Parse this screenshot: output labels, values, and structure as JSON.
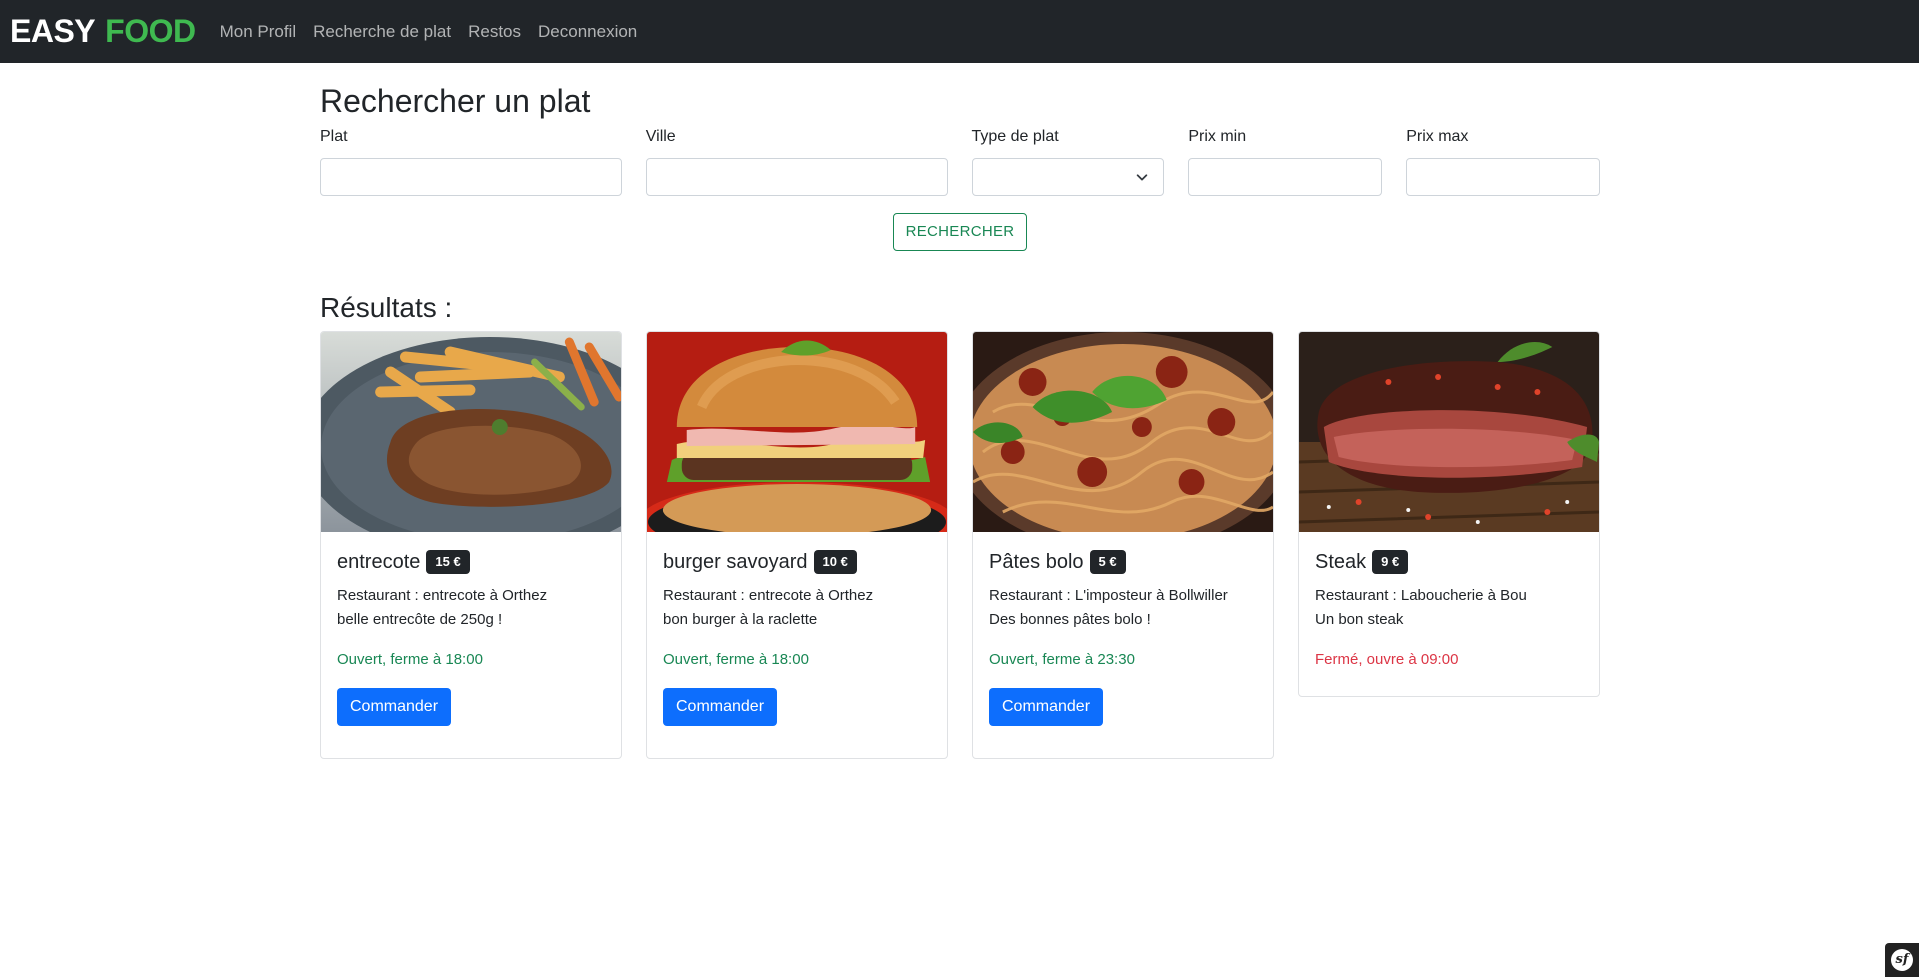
{
  "navbar": {
    "brand_part1": "EASY",
    "brand_part2": "FOOD",
    "links": [
      "Mon Profil",
      "Recherche de plat",
      "Restos",
      "Deconnexion"
    ]
  },
  "search": {
    "title": "Rechercher un plat",
    "fields": {
      "plat": {
        "label": "Plat",
        "value": ""
      },
      "ville": {
        "label": "Ville",
        "value": ""
      },
      "type": {
        "label": "Type de plat",
        "value": ""
      },
      "prix_min": {
        "label": "Prix min",
        "value": ""
      },
      "prix_max": {
        "label": "Prix max",
        "value": ""
      }
    },
    "button_label": "RECHERCHER"
  },
  "results": {
    "title": "Résultats :",
    "order_label": "Commander",
    "cards": [
      {
        "name": "entrecote",
        "price": "15 €",
        "restaurant": "Restaurant : entrecote à Orthez",
        "description": "belle entrecôte de 250g !",
        "status": "Ouvert, ferme à 18:00",
        "open": true
      },
      {
        "name": "burger savoyard",
        "price": "10 €",
        "restaurant": "Restaurant : entrecote à Orthez",
        "description": "bon burger à la raclette",
        "status": "Ouvert, ferme à 18:00",
        "open": true
      },
      {
        "name": "Pâtes bolo",
        "price": "5 €",
        "restaurant": "Restaurant : L'imposteur à Bollwiller",
        "description": "Des bonnes pâtes bolo !",
        "status": "Ouvert, ferme à 23:30",
        "open": true
      },
      {
        "name": "Steak",
        "price": "9 €",
        "restaurant": "Restaurant : Laboucherie à Bou",
        "description": "Un bon steak",
        "status": "Fermé, ouvre à 09:00",
        "open": false
      }
    ]
  },
  "toolbar": {
    "logo": "sf"
  },
  "colors": {
    "navbar_bg": "#212529",
    "brand_accent": "#3fb950",
    "success": "#198754",
    "danger": "#dc3545",
    "primary": "#0d6efd"
  }
}
